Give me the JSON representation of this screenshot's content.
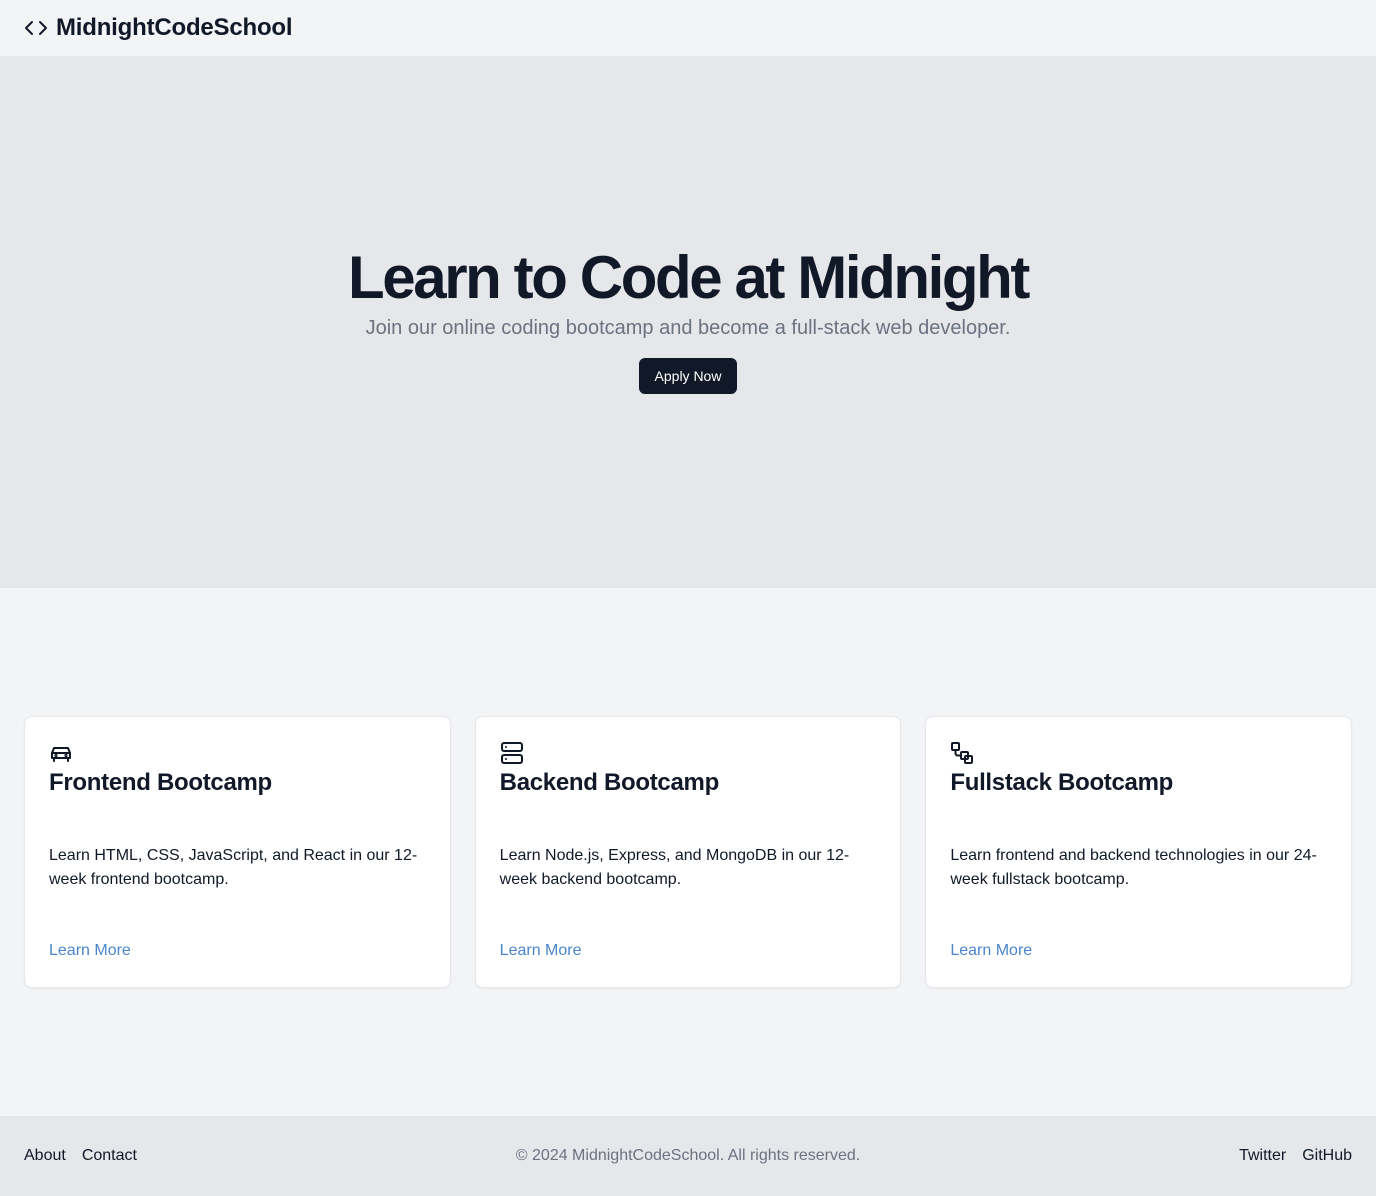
{
  "header": {
    "brand_name": "MidnightCodeSchool",
    "brand_icon": "code-brackets-icon"
  },
  "hero": {
    "title": "Learn to Code at Midnight",
    "subtitle": "Join our online coding bootcamp and become a full-stack web developer.",
    "cta_label": "Apply Now"
  },
  "cards": [
    {
      "icon": "car-icon",
      "title": "Frontend Bootcamp",
      "description": "Learn HTML, CSS, JavaScript, and React in our 12-week frontend bootcamp.",
      "link_label": "Learn More"
    },
    {
      "icon": "server-icon",
      "title": "Backend Bootcamp",
      "description": "Learn Node.js, Express, and MongoDB in our 12-week backend bootcamp.",
      "link_label": "Learn More"
    },
    {
      "icon": "workflow-icon",
      "title": "Fullstack Bootcamp",
      "description": "Learn frontend and backend technologies in our 24-week fullstack bootcamp.",
      "link_label": "Learn More"
    }
  ],
  "footer": {
    "left_links": [
      "About",
      "Contact"
    ],
    "copyright": "© 2024 MidnightCodeSchool. All rights reserved.",
    "right_links": [
      "Twitter",
      "GitHub"
    ]
  },
  "colors": {
    "page_bg": "#f3f4f6",
    "hero_bg": "#e5e7eb",
    "primary": "#111827",
    "muted_text": "#6b7280",
    "link": "#4a86c9"
  }
}
